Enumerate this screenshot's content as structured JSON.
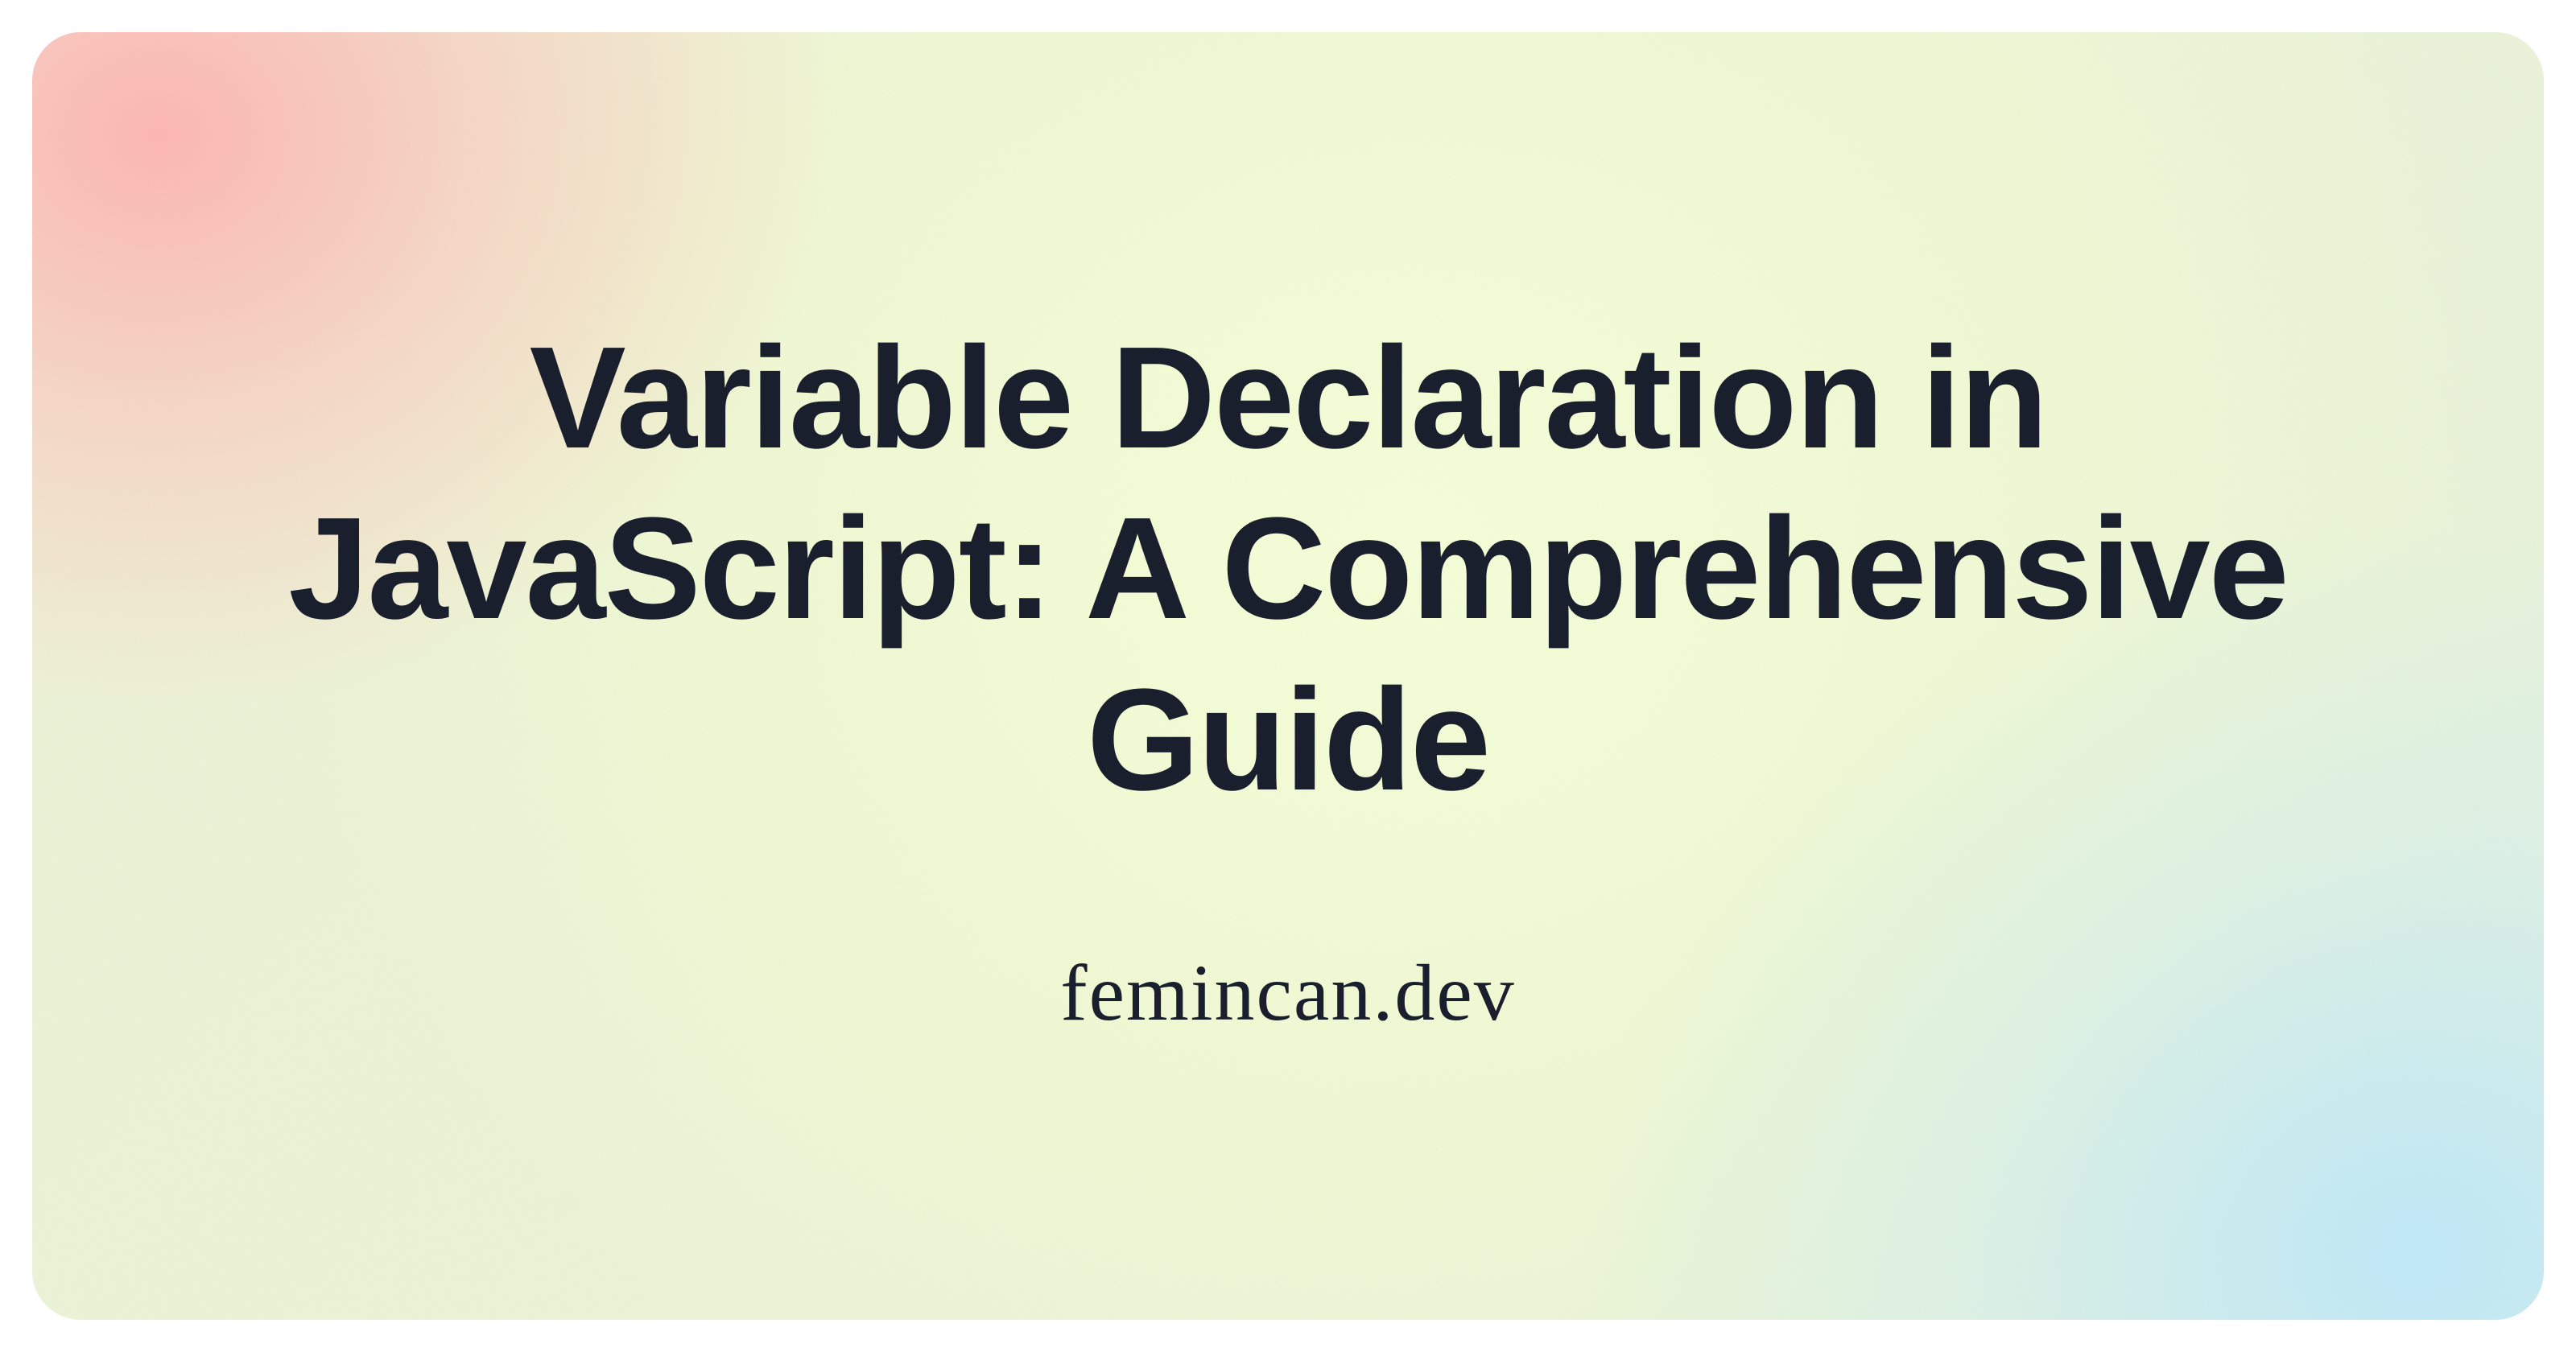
{
  "card": {
    "title": "Variable Declaration in JavaScript: A Comprehensive Guide",
    "attribution": "femincan.dev"
  },
  "colors": {
    "text": "#1a1f2e",
    "gradient_pink": "#ffafaf",
    "gradient_green": "#f0fad2",
    "gradient_blue": "#b4e6ff"
  }
}
